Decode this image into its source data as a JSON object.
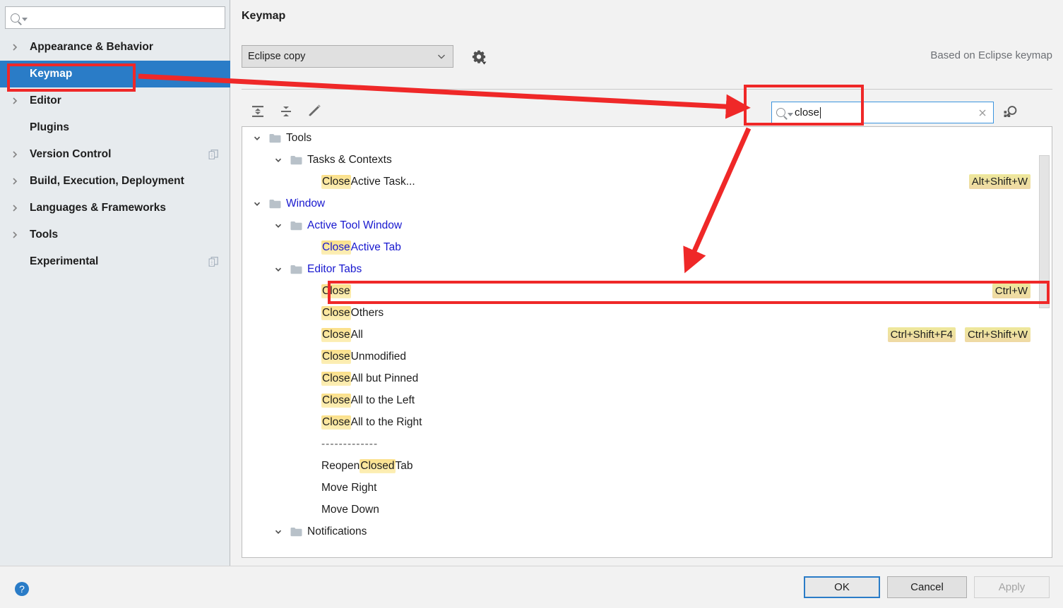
{
  "sidebar": {
    "search": {
      "value": "",
      "placeholder": ""
    },
    "items": [
      {
        "label": "Appearance & Behavior",
        "expandable": true,
        "selected": false,
        "copy_icon": false
      },
      {
        "label": "Keymap",
        "expandable": false,
        "selected": true,
        "copy_icon": false
      },
      {
        "label": "Editor",
        "expandable": true,
        "selected": false,
        "copy_icon": false
      },
      {
        "label": "Plugins",
        "expandable": false,
        "selected": false,
        "copy_icon": false
      },
      {
        "label": "Version Control",
        "expandable": true,
        "selected": false,
        "copy_icon": true
      },
      {
        "label": "Build, Execution, Deployment",
        "expandable": true,
        "selected": false,
        "copy_icon": false
      },
      {
        "label": "Languages & Frameworks",
        "expandable": true,
        "selected": false,
        "copy_icon": false
      },
      {
        "label": "Tools",
        "expandable": true,
        "selected": false,
        "copy_icon": false
      },
      {
        "label": "Experimental",
        "expandable": false,
        "selected": false,
        "copy_icon": true
      }
    ]
  },
  "content": {
    "title": "Keymap",
    "keymap_select": {
      "value": "Eclipse copy"
    },
    "gear_tooltip": "Show Scheme Actions",
    "based_on": "Based on Eclipse keymap",
    "toolbar": [
      {
        "name": "expand-all-icon",
        "label": "Expand All"
      },
      {
        "name": "collapse-all-icon",
        "label": "Collapse All"
      },
      {
        "name": "edit-shortcut-icon",
        "label": "Edit Shortcut"
      }
    ],
    "search": {
      "value": "close",
      "clear_label": "×"
    },
    "find_by_shortcut_label": "Find Actions by Shortcut"
  },
  "tree": {
    "rows": [
      {
        "indent": 0,
        "type": "folder",
        "arrow": "down",
        "segments": [
          {
            "text": "Tools",
            "hl": false
          }
        ],
        "blue": false,
        "shortcuts": []
      },
      {
        "indent": 1,
        "type": "folder",
        "arrow": "down",
        "segments": [
          {
            "text": "Tasks & Contexts",
            "hl": false
          }
        ],
        "blue": false,
        "shortcuts": []
      },
      {
        "indent": 2,
        "type": "action",
        "arrow": "none",
        "segments": [
          {
            "text": "Close",
            "hl": true
          },
          {
            "text": " Active Task...",
            "hl": false
          }
        ],
        "blue": false,
        "shortcuts": [
          "Alt+Shift+W"
        ]
      },
      {
        "indent": 0,
        "type": "folder",
        "arrow": "down",
        "segments": [
          {
            "text": "Window",
            "hl": false
          }
        ],
        "blue": true,
        "shortcuts": []
      },
      {
        "indent": 1,
        "type": "folder",
        "arrow": "down",
        "segments": [
          {
            "text": "Active Tool Window",
            "hl": false
          }
        ],
        "blue": true,
        "shortcuts": []
      },
      {
        "indent": 2,
        "type": "action",
        "arrow": "none",
        "segments": [
          {
            "text": "Close",
            "hl": true
          },
          {
            "text": " Active Tab",
            "hl": false
          }
        ],
        "blue": true,
        "shortcuts": []
      },
      {
        "indent": 1,
        "type": "folder",
        "arrow": "down",
        "segments": [
          {
            "text": "Editor Tabs",
            "hl": false
          }
        ],
        "blue": true,
        "shortcuts": []
      },
      {
        "indent": 2,
        "type": "action",
        "arrow": "none",
        "segments": [
          {
            "text": "Close",
            "hl": true
          }
        ],
        "blue": false,
        "shortcuts": [
          "Ctrl+W"
        ]
      },
      {
        "indent": 2,
        "type": "action",
        "arrow": "none",
        "segments": [
          {
            "text": "Close",
            "hl": true
          },
          {
            "text": " Others",
            "hl": false
          }
        ],
        "blue": false,
        "shortcuts": []
      },
      {
        "indent": 2,
        "type": "action",
        "arrow": "none",
        "segments": [
          {
            "text": "Close",
            "hl": true
          },
          {
            "text": " All",
            "hl": false
          }
        ],
        "blue": false,
        "shortcuts": [
          "Ctrl+Shift+F4",
          "Ctrl+Shift+W"
        ]
      },
      {
        "indent": 2,
        "type": "action",
        "arrow": "none",
        "segments": [
          {
            "text": "Close",
            "hl": true
          },
          {
            "text": " Unmodified",
            "hl": false
          }
        ],
        "blue": false,
        "shortcuts": []
      },
      {
        "indent": 2,
        "type": "action",
        "arrow": "none",
        "segments": [
          {
            "text": "Close",
            "hl": true
          },
          {
            "text": " All but Pinned",
            "hl": false
          }
        ],
        "blue": false,
        "shortcuts": []
      },
      {
        "indent": 2,
        "type": "action",
        "arrow": "none",
        "segments": [
          {
            "text": "Close",
            "hl": true
          },
          {
            "text": " All to the Left",
            "hl": false
          }
        ],
        "blue": false,
        "shortcuts": []
      },
      {
        "indent": 2,
        "type": "action",
        "arrow": "none",
        "segments": [
          {
            "text": "Close",
            "hl": true
          },
          {
            "text": " All to the Right",
            "hl": false
          }
        ],
        "blue": false,
        "shortcuts": []
      },
      {
        "indent": 2,
        "type": "separator",
        "arrow": "none",
        "segments": [
          {
            "text": "-------------",
            "hl": false
          }
        ],
        "blue": false,
        "shortcuts": []
      },
      {
        "indent": 2,
        "type": "action",
        "arrow": "none",
        "segments": [
          {
            "text": "Reopen ",
            "hl": false
          },
          {
            "text": "Closed",
            "hl": true
          },
          {
            "text": " Tab",
            "hl": false
          }
        ],
        "blue": false,
        "shortcuts": []
      },
      {
        "indent": 2,
        "type": "action",
        "arrow": "none",
        "segments": [
          {
            "text": "Move Right",
            "hl": false
          }
        ],
        "blue": false,
        "shortcuts": []
      },
      {
        "indent": 2,
        "type": "action",
        "arrow": "none",
        "segments": [
          {
            "text": "Move Down",
            "hl": false
          }
        ],
        "blue": false,
        "shortcuts": []
      },
      {
        "indent": 1,
        "type": "folder",
        "arrow": "down",
        "segments": [
          {
            "text": "Notifications",
            "hl": false
          }
        ],
        "blue": false,
        "shortcuts": []
      }
    ],
    "selected_row_index": 7
  },
  "footer": {
    "help_label": "?",
    "ok": "OK",
    "cancel": "Cancel",
    "apply": "Apply"
  },
  "annotations": {
    "color": "#ef2828",
    "boxes": [
      "keymap-sidebar-item",
      "search-field",
      "close-action-row"
    ],
    "arrows": [
      "keymap-to-search",
      "search-to-close-row"
    ]
  },
  "colors": {
    "selection_blue": "#2a7cc7",
    "modified_text_blue": "#1818cf",
    "match_highlight": "#fbe08a",
    "shortcut_badge": "#eee89b",
    "annotation_red": "#ef2828",
    "sidebar_bg": "#e7ebee",
    "panel_bg": "#f2f2f2"
  }
}
